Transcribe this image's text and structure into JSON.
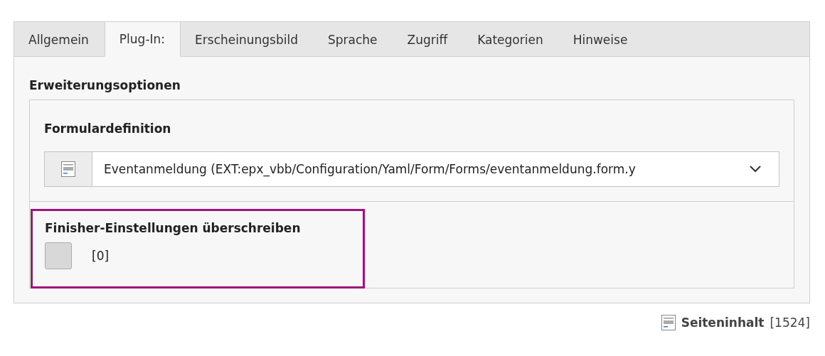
{
  "tabs": [
    {
      "label": "Allgemein",
      "selected": false
    },
    {
      "label": "Plug-In:",
      "selected": true
    },
    {
      "label": "Erscheinungsbild",
      "selected": false
    },
    {
      "label": "Sprache",
      "selected": false
    },
    {
      "label": "Zugriff",
      "selected": false
    },
    {
      "label": "Kategorien",
      "selected": false
    },
    {
      "label": "Hinweise",
      "selected": false
    }
  ],
  "section": {
    "title": "Erweiterungsoptionen",
    "fields": [
      {
        "kind": "select",
        "label": "Formulardefinition",
        "value": "Eventanmeldung (EXT:epx_vbb/Configuration/Yaml/Form/Forms/eventanmeldung.form.y",
        "highlighted": false
      },
      {
        "kind": "checkbox",
        "label": "Finisher-Einstellungen überschreiben",
        "checked": false,
        "value": "[0]",
        "highlighted": true
      }
    ]
  },
  "footer": {
    "record_type": "Seiteninhalt",
    "record_id": "[1524]"
  }
}
